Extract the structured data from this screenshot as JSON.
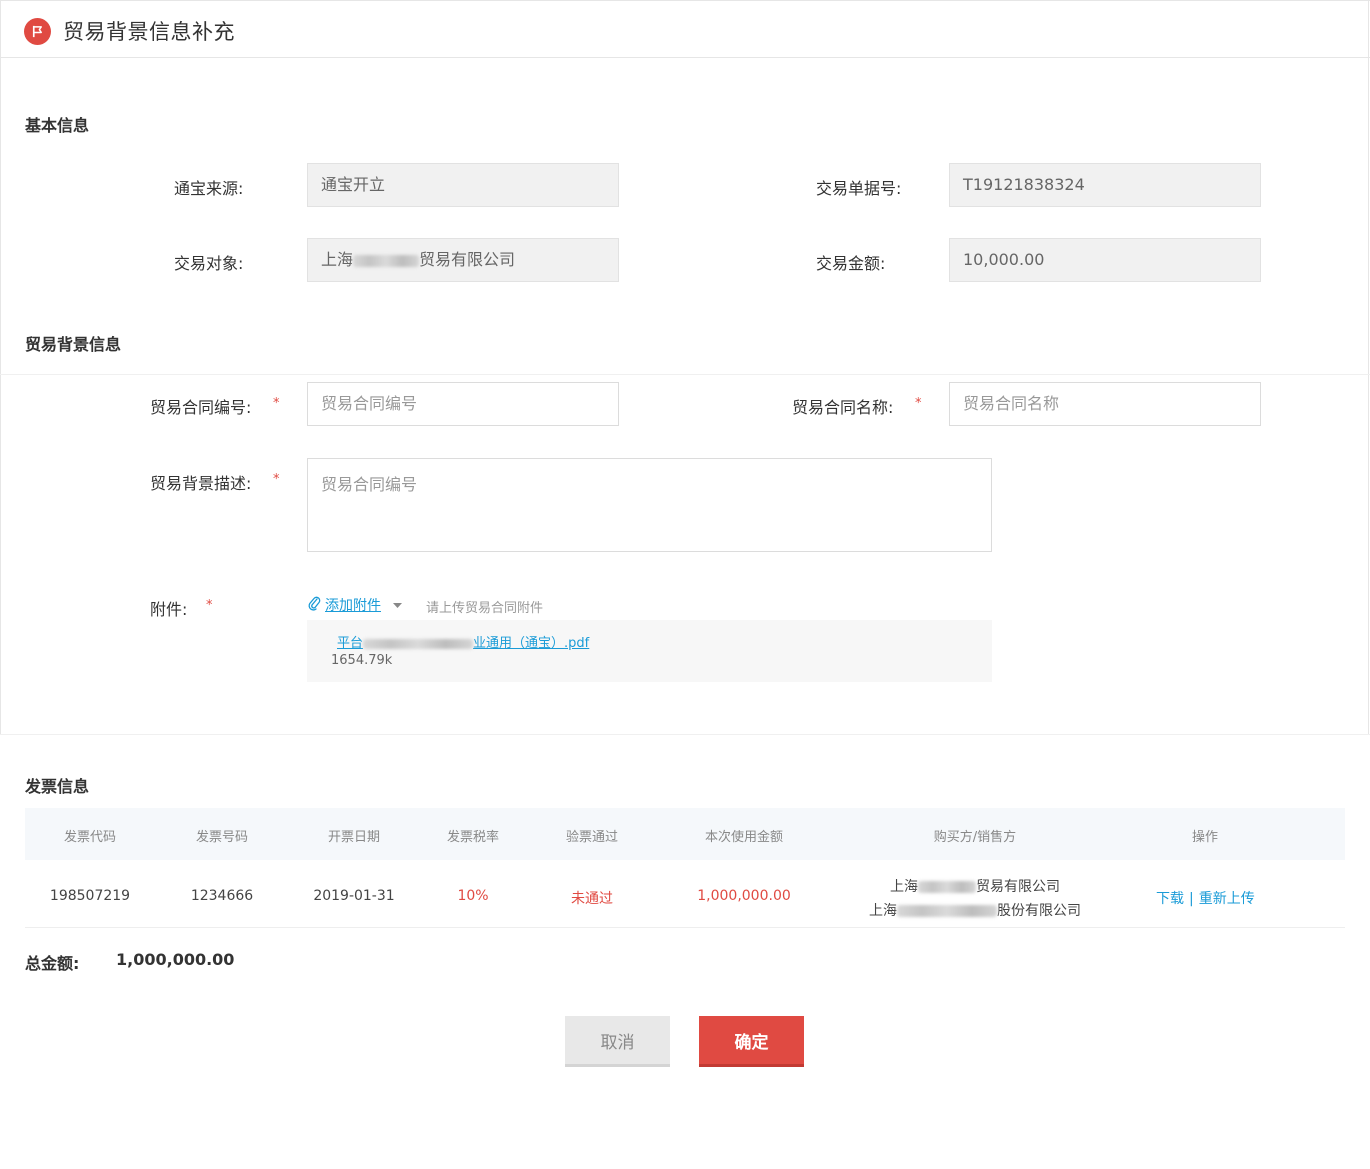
{
  "header": {
    "title": "贸易背景信息补充",
    "icon": "flag-icon"
  },
  "basic": {
    "section_title": "基本信息",
    "source_label": "通宝来源:",
    "source_value": "通宝开立",
    "order_label": "交易单据号:",
    "order_value": "T19121838324",
    "party_label": "交易对象:",
    "party_prefix": "上海",
    "party_suffix": "贸易有限公司",
    "amount_label": "交易金额:",
    "amount_value": "10,000.00"
  },
  "trade": {
    "section_title": "贸易背景信息",
    "contract_no_label": "贸易合同编号:",
    "contract_no_placeholder": "贸易合同编号",
    "contract_name_label": "贸易合同名称:",
    "contract_name_placeholder": "贸易合同名称",
    "desc_label": "贸易背景描述:",
    "desc_placeholder": "贸易合同编号",
    "required_mark": "*",
    "attach_label": "附件:",
    "attach_link": "添加附件",
    "attach_hint": "请上传贸易合同附件",
    "file_prefix": "平台",
    "file_middle": "业通用（通宝）",
    "file_ext": ".pdf",
    "file_size": "1654.79k"
  },
  "invoice": {
    "section_title": "发票信息",
    "columns": [
      "发票代码",
      "发票号码",
      "开票日期",
      "发票税率",
      "验票通过",
      "本次使用金额",
      "购买方/销售方",
      "操作"
    ],
    "row": {
      "code": "198507219",
      "number": "1234666",
      "date": "2019-01-31",
      "tax_rate": "10%",
      "verified": "未通过",
      "amount": "1,000,000.00",
      "buyer_prefix": "上海",
      "buyer_suffix": "贸易有限公司",
      "seller_prefix": "上海",
      "seller_suffix": "股份有限公司",
      "op_download": "下载",
      "op_separator": "|",
      "op_reupload": "重新上传"
    }
  },
  "total": {
    "label": "总金额:",
    "value": "1,000,000.00"
  },
  "actions": {
    "cancel": "取消",
    "confirm": "确定"
  },
  "colors": {
    "accent": "#e04a42",
    "link": "#1a9bd7"
  }
}
